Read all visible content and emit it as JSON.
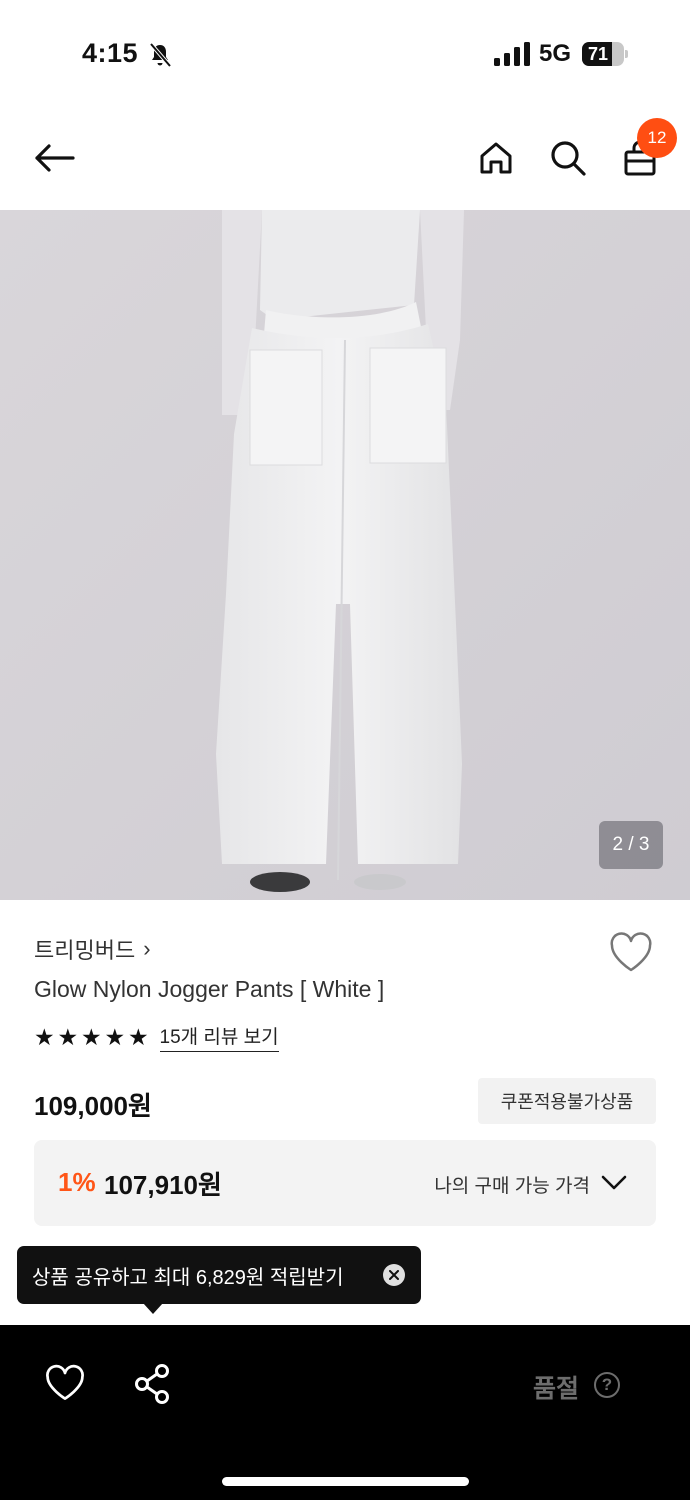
{
  "status_bar": {
    "time": "4:15",
    "network": "5G",
    "battery": "71",
    "battery_level": 0.71
  },
  "header": {
    "cart_count": "12"
  },
  "gallery": {
    "counter": "2 / 3"
  },
  "product": {
    "brand": "트리밍버드",
    "brand_chevron": "›",
    "name": "Glow Nylon Jogger Pants [ White ]",
    "rating": 5,
    "review_link": "15개 리뷰 보기",
    "price": "109,000원",
    "coupon_note": "쿠폰적용불가상품",
    "discount_rate": "1%",
    "discount_price": "107,910원",
    "my_price_label": "나의 구매 가능 가격"
  },
  "tooltip": {
    "text": "상품 공유하고 최대 6,829원 적립받기"
  },
  "bottom_bar": {
    "status": "품절",
    "help": "?"
  },
  "colors": {
    "accent": "#ff4e12",
    "discount": "#ff5517",
    "bottom_bar": "#000000"
  }
}
